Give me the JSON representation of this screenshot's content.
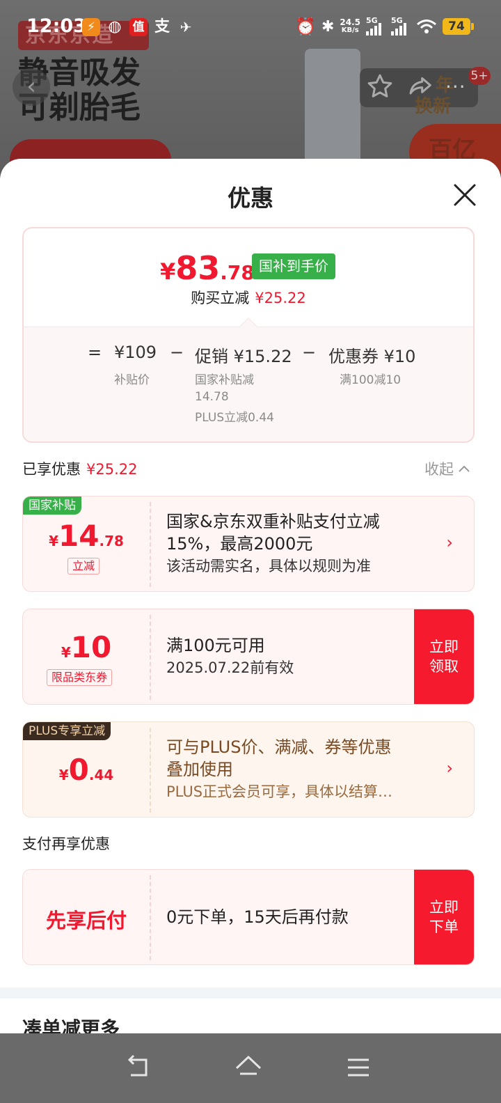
{
  "status_bar": {
    "time": "12:03",
    "net_speed_value": "24.5",
    "net_speed_unit": "KB/s",
    "signal_1": "5G",
    "signal_2": "5G",
    "battery": "74"
  },
  "background": {
    "ad_tag": "京东京造",
    "headline_line1": "静音吸发",
    "headline_line2": "可剃胎毛",
    "cart_badge": "5+",
    "promo_text_1": "年",
    "promo_text_2": "换新",
    "promo_circle": "百亿"
  },
  "sheet": {
    "title": "优惠"
  },
  "summary": {
    "final_price_currency": "¥",
    "final_price_int": "83",
    "final_price_dec": ".78",
    "final_tag": "国补到手价",
    "cut_label": "购买立减",
    "cut_amount": "¥25.22",
    "eq": "=",
    "base_price": "¥109",
    "base_label": "补贴价",
    "minus1": "−",
    "promo_label": "促销 ¥15.22",
    "promo_sub1": "国家补贴减",
    "promo_sub2": "14.78",
    "promo_sub3": "PLUS立减0.44",
    "minus2": "−",
    "coupon_label": "优惠券 ¥10",
    "coupon_sub": "满100减10"
  },
  "enjoyed": {
    "label": "已享优惠",
    "amount": "¥25.22",
    "collapse": "收起"
  },
  "coupons": [
    {
      "corner_tag": "国家补贴",
      "currency": "¥",
      "int": "14",
      "dec": ".78",
      "mini_tag": "立减",
      "line1": "国家&京东双重补贴支付立减",
      "line2": "15%，最高2000元",
      "line3": "该活动需实名，具体以规则为准"
    },
    {
      "currency": "¥",
      "int": "10",
      "mini_tag": "限品类东券",
      "line1": "满100元可用",
      "line2": "2025.07.22前有效",
      "cta_1": "立即",
      "cta_2": "领取"
    },
    {
      "corner_tag": "PLUS专享立减",
      "currency": "¥",
      "int": "0",
      "dec": ".44",
      "line1": "可与PLUS价、满减、券等优惠",
      "line2": "叠加使用",
      "line3": "PLUS正式会员可享，具体以结算…"
    }
  ],
  "payment": {
    "section_title": "支付再享优惠",
    "left_text": "先享后付",
    "desc": "0元下单，15天后再付款",
    "cta_1": "立即",
    "cta_2": "下单"
  },
  "more_title": "凑单减更多",
  "colors": {
    "accent_red": "#f0192f",
    "cta_red": "#f51a2d",
    "green_tag": "#37b049",
    "plus_brown": "#7a4a22"
  },
  "icons": {
    "close": "close-icon",
    "collapse": "chevron-up-icon",
    "arrow": "chevron-right-icon",
    "nav_back": "back-icon",
    "nav_home": "home-icon",
    "nav_menu": "menu-icon"
  }
}
